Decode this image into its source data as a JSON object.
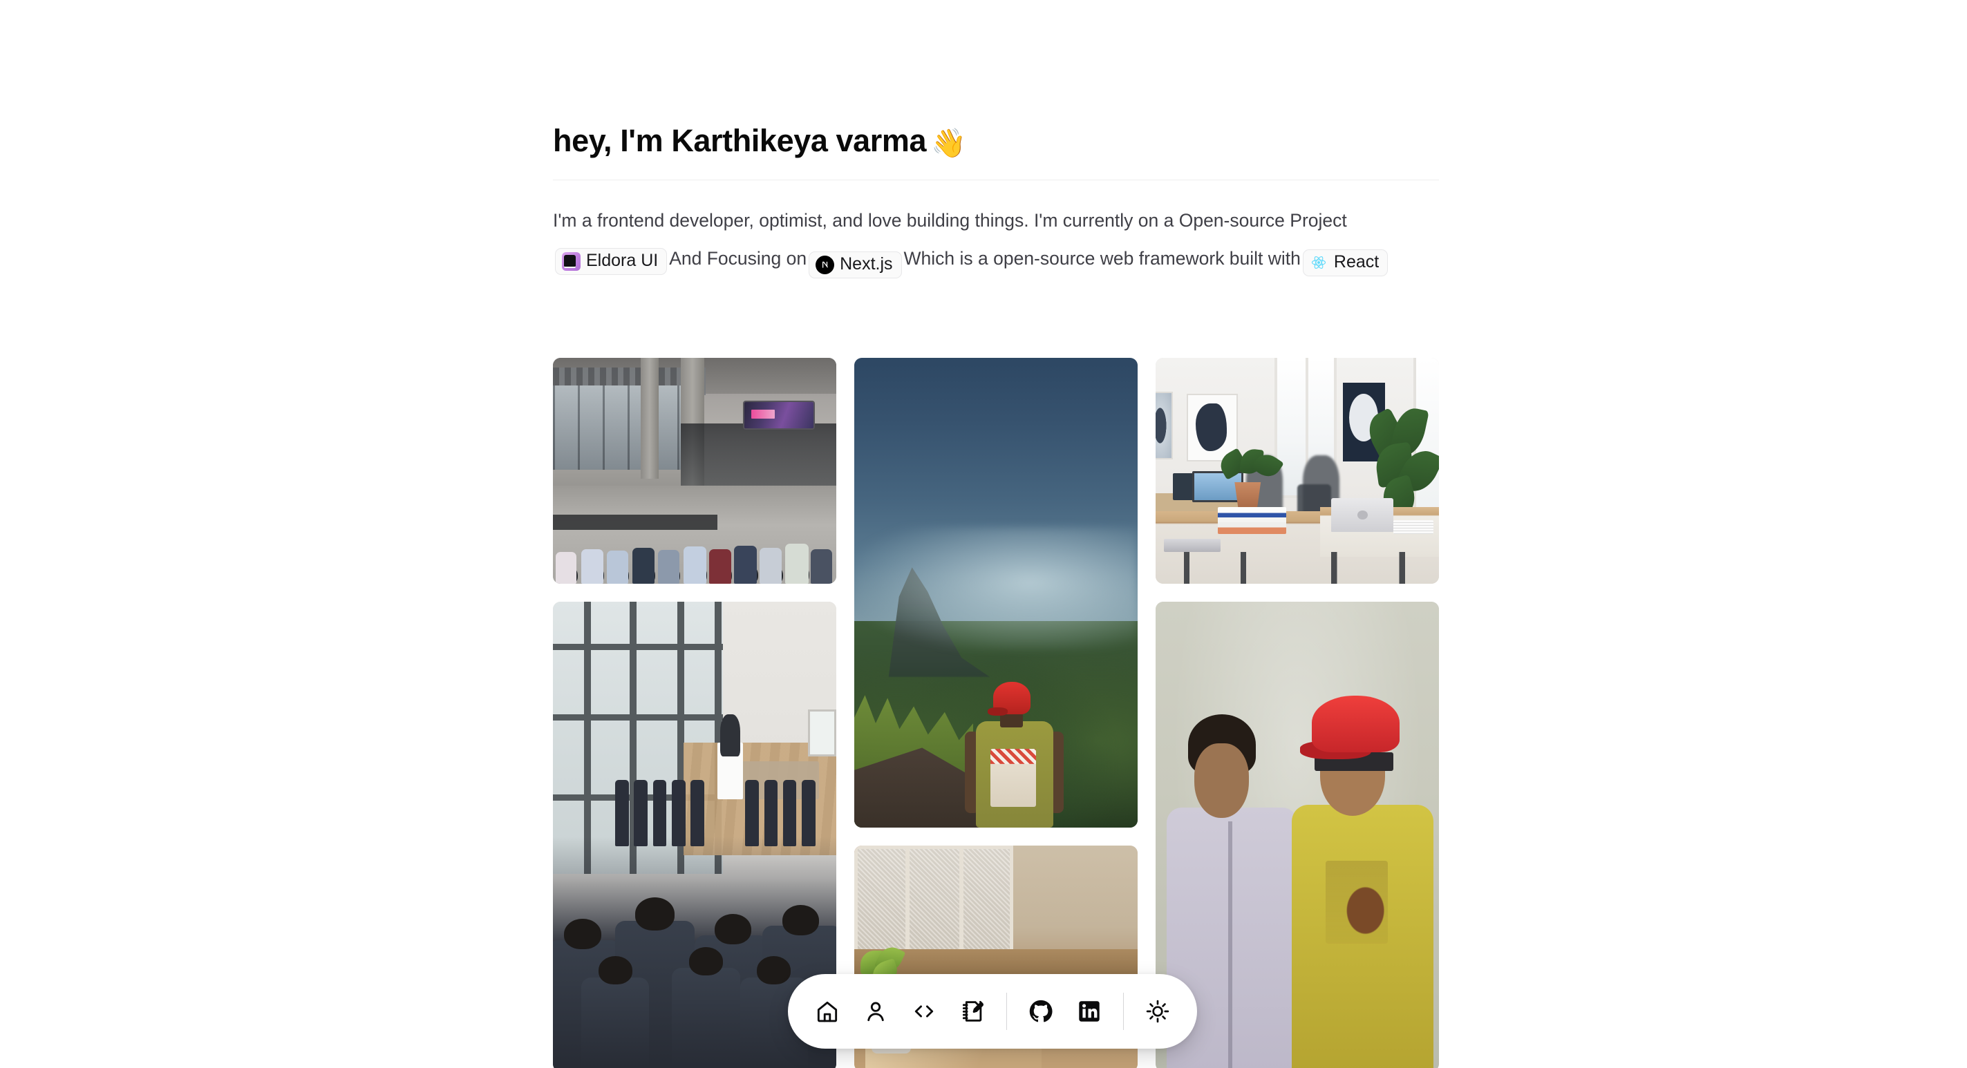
{
  "header": {
    "title": "hey, I'm Karthikeya varma",
    "wave_emoji": "👋"
  },
  "bio": {
    "part1": "I'm a frontend developer, optimist, and love building things. I'm currently on a Open-source Project",
    "part2": "And Focusing on",
    "part3": "Which is a open-source web framework built with",
    "badges": {
      "eldora": {
        "label": "Eldora UI",
        "icon": "eldora-ui-logo-icon",
        "color": "#c07fe0"
      },
      "nextjs": {
        "label": "Next.js",
        "icon": "nextjs-logo-icon",
        "color": "#000000"
      },
      "react": {
        "label": "React",
        "icon": "react-logo-icon",
        "color": "#61dafb"
      }
    }
  },
  "gallery": {
    "photos": [
      {
        "name": "photo-conference-hall",
        "alt": "Audience seated at an outdoor tech conference in a concrete atrium with a presentation screen"
      },
      {
        "name": "photo-misty-mountain",
        "alt": "Person in a red cap looking out over misty green mountains"
      },
      {
        "name": "photo-office-workspace",
        "alt": "Bright modern office with plants, books and a laptop on wooden desks"
      },
      {
        "name": "photo-seminar-audience",
        "alt": "Formal seminar hall with suited attendees facing a speaker at a podium"
      },
      {
        "name": "photo-windowsill-lamp",
        "alt": "Sunlit windowsill with a plant, mug, small speaker and a warm glowing lamp"
      },
      {
        "name": "photo-two-friends",
        "alt": "Two friends posing together, one in a lavender shirt and one in a yellow tee with a red cap"
      }
    ]
  },
  "dock": {
    "items": [
      {
        "name": "dock-home",
        "icon": "home-icon",
        "label": "Home"
      },
      {
        "name": "dock-about",
        "icon": "user-icon",
        "label": "About"
      },
      {
        "name": "dock-projects",
        "icon": "code-icon",
        "label": "Projects"
      },
      {
        "name": "dock-blog",
        "icon": "notebook-pen-icon",
        "label": "Blog"
      },
      {
        "name": "dock-github",
        "icon": "github-icon",
        "label": "GitHub"
      },
      {
        "name": "dock-linkedin",
        "icon": "linkedin-icon",
        "label": "LinkedIn"
      },
      {
        "name": "dock-theme",
        "icon": "sun-icon",
        "label": "Toggle theme"
      }
    ]
  },
  "colors": {
    "background": "#ffffff",
    "text": "#0a0a0a",
    "muted": "#3f3f46",
    "divider": "#eeeeee",
    "badge_bg": "#fafafa",
    "badge_border": "#e7e7e9"
  }
}
